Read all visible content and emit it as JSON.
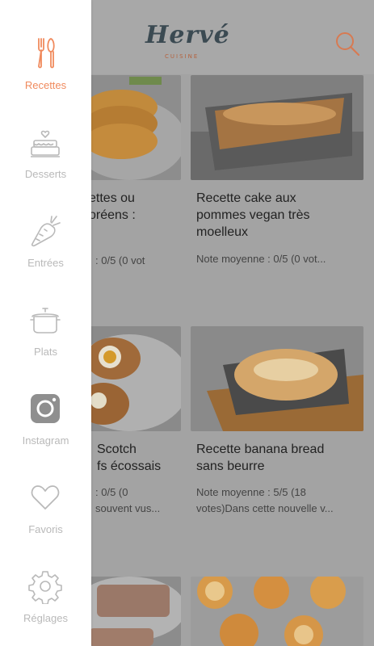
{
  "brand": {
    "name": "Hervé",
    "subtitle": "CUISINE"
  },
  "colors": {
    "accent": "#f08a5d",
    "muted": "#b9b9b9",
    "sidebar_bg": "#ffffff"
  },
  "sidebar": {
    "items": [
      {
        "label": "Recettes",
        "icon": "fork-knife-icon",
        "active": true
      },
      {
        "label": "Desserts",
        "icon": "cake-icon",
        "active": false
      },
      {
        "label": "Entrées",
        "icon": "carrot-icon",
        "active": false
      },
      {
        "label": "Plats",
        "icon": "pot-icon",
        "active": false
      },
      {
        "label": "Instagram",
        "icon": "instagram-icon",
        "active": false
      },
      {
        "label": "Favoris",
        "icon": "heart-icon",
        "active": false
      },
      {
        "label": "Réglages",
        "icon": "gear-icon",
        "active": false
      }
    ]
  },
  "recipes": [
    {
      "title_line1": "ettes ou",
      "title_line2": "oréens :",
      "title_line3": "",
      "rating_line1": ": 0/5 (0 vot",
      "rating_line2": ""
    },
    {
      "title_line1": "Recette cake aux",
      "title_line2": "pommes vegan très",
      "title_line3": "moelleux",
      "rating_line1": "Note moyenne : 0/5 (0 vot...",
      "rating_line2": ""
    },
    {
      "title_line1": "Scotch",
      "title_line2": "fs écossais",
      "title_line3": "",
      "rating_line1": ": 0/5 (0",
      "rating_line2": "souvent vus..."
    },
    {
      "title_line1": "Recette banana bread",
      "title_line2": "sans beurre",
      "title_line3": "",
      "rating_line1": "Note moyenne : 5/5 (18",
      "rating_line2": "votes)Dans cette nouvelle v..."
    }
  ]
}
